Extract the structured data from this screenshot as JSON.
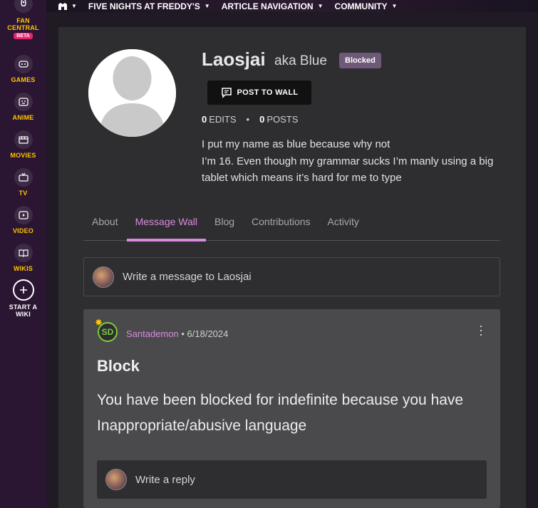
{
  "global_nav": {
    "items": [
      {
        "label": "FAN\nCENTRAL",
        "icon": "rocket-icon",
        "badge": "BETA"
      },
      {
        "label": "GAMES",
        "icon": "gamepad-icon"
      },
      {
        "label": "ANIME",
        "icon": "anime-icon"
      },
      {
        "label": "MOVIES",
        "icon": "clapperboard-icon"
      },
      {
        "label": "TV",
        "icon": "tv-icon"
      },
      {
        "label": "VIDEO",
        "icon": "play-icon"
      },
      {
        "label": "WIKIS",
        "icon": "book-icon"
      },
      {
        "label": "START A\nWIKI",
        "icon": "plus-icon"
      }
    ]
  },
  "topbar": {
    "menus": [
      "FIVE NIGHTS AT FREDDY'S",
      "ARTICLE NAVIGATION",
      "COMMUNITY"
    ]
  },
  "profile": {
    "username": "Laosjai",
    "aka": "aka Blue",
    "badge": "Blocked",
    "post_button": "POST TO WALL",
    "edits_count": "0",
    "edits_label": "EDITS",
    "posts_count": "0",
    "posts_label": "POSTS",
    "bio": "I put my name as blue because why not\nI’m 16. Even though my grammar sucks I’m manly using a big  tablet which means it’s hard for me to type"
  },
  "tabs": [
    "About",
    "Message Wall",
    "Blog",
    "Contributions",
    "Activity"
  ],
  "active_tab": "Message Wall",
  "composer": {
    "placeholder": "Write a message to Laosjai"
  },
  "post": {
    "avatar_initials": "SD",
    "author": "Santademon",
    "date": "6/18/2024",
    "title": "Block",
    "body": "You have been blocked for indefinite because you have Inappropriate/abusive language",
    "reply_placeholder": "Write a reply"
  },
  "colors": {
    "accent": "#d88adf",
    "nav_label": "#ffc500",
    "beta": "#e8236b",
    "blocked_badge": "#6e5a78"
  }
}
